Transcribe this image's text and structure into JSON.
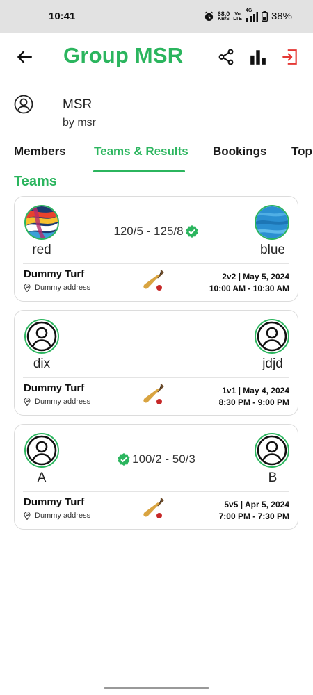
{
  "status_bar": {
    "time": "10:41",
    "net_speed_top": "68.0",
    "net_speed_unit": "KB/S",
    "volte_top": "Vo",
    "volte_bottom": "LTE",
    "network": "4G",
    "battery": "38%"
  },
  "header": {
    "title": "Group MSR",
    "icons": [
      "back-arrow-icon",
      "share-icon",
      "bar-chart-icon",
      "exit-icon"
    ]
  },
  "group": {
    "name": "MSR",
    "by": "by msr"
  },
  "tabs": [
    {
      "label": "Members"
    },
    {
      "label": "Teams & Results"
    },
    {
      "label": "Bookings"
    },
    {
      "label": "Top"
    }
  ],
  "active_tab": "Teams & Results",
  "section_title": "Teams",
  "matches": [
    {
      "team_left": "red",
      "team_right": "blue",
      "score": "120/5 - 125/8",
      "winner": "right",
      "venue": "Dummy Turf",
      "address": "Dummy address",
      "format_date": "2v2 | May 5, 2024",
      "time_range": "10:00 AM - 10:30 AM"
    },
    {
      "team_left": "dix",
      "team_right": "jdjd",
      "score": "",
      "winner": "",
      "venue": "Dummy Turf",
      "address": "Dummy address",
      "format_date": "1v1 | May 4, 2024",
      "time_range": "8:30 PM - 9:00 PM"
    },
    {
      "team_left": "A",
      "team_right": "B",
      "score": "100/2 - 50/3",
      "winner": "left",
      "venue": "Dummy Turf",
      "address": "Dummy address",
      "format_date": "5v5 | Apr 5, 2024",
      "time_range": "7:00 PM - 7:30 PM"
    }
  ],
  "colors": {
    "accent": "#2bb55e",
    "exit_icon": "#e53935",
    "ball": "#c62828",
    "bat": "#d9a441"
  }
}
